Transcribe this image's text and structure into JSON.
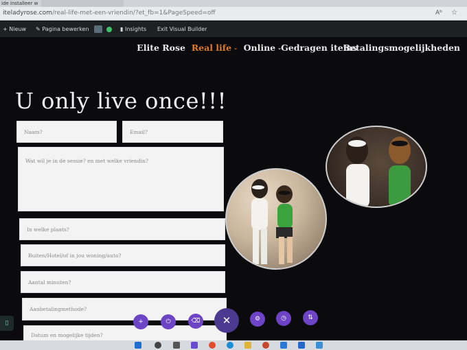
{
  "browser": {
    "tab1_title": "ide installeer w",
    "url_host": "iteladyrose.com",
    "url_path": "/real-life-met-een-vriendin/?et_fb=1&PageSpeed=off",
    "reader_icon": "reader-mode-icon",
    "favorites_icon": "favorites-star-icon"
  },
  "adminbar": {
    "new_label": "Nieuw",
    "edit_label": "Pagina bewerken",
    "insights_label": "Insights",
    "exit_label": "Exit Visual Builder"
  },
  "nav": {
    "items": [
      {
        "label": "Elite Rose"
      },
      {
        "label": "Real life"
      },
      {
        "label": "Online"
      },
      {
        "label": "Gedragen items"
      },
      {
        "label": "Betalingsmogelijkheden"
      }
    ],
    "active_color": "#e07a2a"
  },
  "headline": "U only live once!!!",
  "form": {
    "name_placeholder": "Naam?",
    "email_placeholder": "Email?",
    "message_placeholder": "Wat wil je in de sessie? en met welke vriendin?",
    "place_placeholder": "In welke plaats?",
    "location_placeholder": "Buiten/Hotel/of in jou woning/auto?",
    "minutes_placeholder": "Aantal minuten?",
    "payment_placeholder": "Aanbetalingmethode?",
    "date_placeholder": "Datum en mogelijke tijden?"
  },
  "builder": {
    "accent": "#6e44c7",
    "close_color": "#4b3a8f",
    "buttons": [
      "add-icon",
      "power-icon",
      "trash-icon",
      "close-icon",
      "gear-icon",
      "history-icon",
      "sort-icon"
    ]
  }
}
